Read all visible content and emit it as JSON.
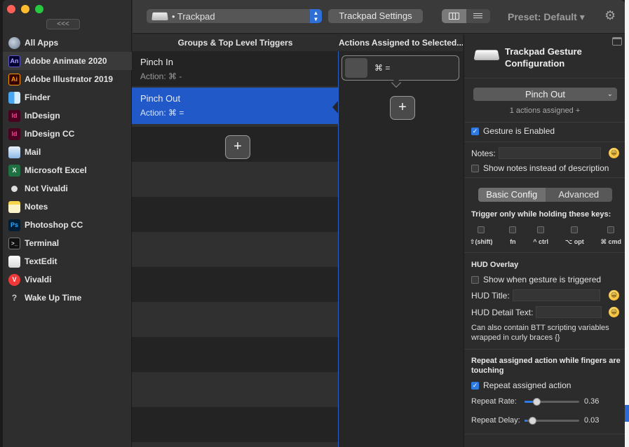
{
  "window": {
    "collapse_label": "<<<"
  },
  "sidebar": {
    "items": [
      {
        "label": "All Apps"
      },
      {
        "label": "Adobe Animate 2020",
        "icon": "An"
      },
      {
        "label": "Adobe Illustrator 2019",
        "icon": "Ai"
      },
      {
        "label": "Finder"
      },
      {
        "label": "InDesign",
        "icon": "Id"
      },
      {
        "label": "InDesign CC",
        "icon": "Id"
      },
      {
        "label": "Mail"
      },
      {
        "label": "Microsoft Excel",
        "icon": "X"
      },
      {
        "label": "Not Vivaldi"
      },
      {
        "label": "Notes"
      },
      {
        "label": "Photoshop CC",
        "icon": "Ps"
      },
      {
        "label": "Terminal",
        "icon": ">_"
      },
      {
        "label": "TextEdit"
      },
      {
        "label": "Vivaldi",
        "icon": "V"
      },
      {
        "label": "Wake Up Time",
        "icon": "?"
      }
    ]
  },
  "toolbar": {
    "device": "• Trackpad",
    "settings_label": "Trackpad Settings",
    "preset_label": "Preset: Default ▾"
  },
  "triggers": {
    "header": "Groups & Top Level Triggers",
    "items": [
      {
        "name": "Pinch In",
        "action": "Action: ⌘ -"
      },
      {
        "name": "Pinch Out",
        "action": "Action: ⌘ ="
      }
    ],
    "add_label": "+"
  },
  "actions": {
    "header": "Actions Assigned to Selected...",
    "items": [
      {
        "label": "⌘ ="
      }
    ],
    "add_label": "+"
  },
  "config": {
    "title": "Trackpad Gesture Configuration",
    "gesture": "Pinch Out",
    "assigned_text": "1 actions assigned +",
    "enabled_label": "Gesture is Enabled",
    "enabled": true,
    "notes_label": "Notes:",
    "show_notes_label": "Show notes instead of description",
    "tabs": [
      "Basic Config",
      "Advanced"
    ],
    "keys_heading": "Trigger only while holding these keys:",
    "keys": [
      "⇧(shift)",
      "fn",
      "^ ctrl",
      "⌥ opt",
      "⌘ cmd"
    ],
    "hud_heading": "HUD Overlay",
    "hud_show_label": "Show when gesture is triggered",
    "hud_title_label": "HUD Title:",
    "hud_detail_label": "HUD Detail Text:",
    "hud_note": "Can also contain BTT scripting variables wrapped in curly braces {}",
    "repeat_heading": "Repeat assigned action while fingers are touching",
    "repeat_label": "Repeat assigned action",
    "repeat_enabled": true,
    "repeat_rate_label": "Repeat Rate:",
    "repeat_rate": "0.36",
    "repeat_delay_label": "Repeat Delay:",
    "repeat_delay": "0.03",
    "emoji": "😀"
  },
  "colors": {
    "accent": "#2159c9",
    "checkbox_on": "#2f7be6"
  }
}
